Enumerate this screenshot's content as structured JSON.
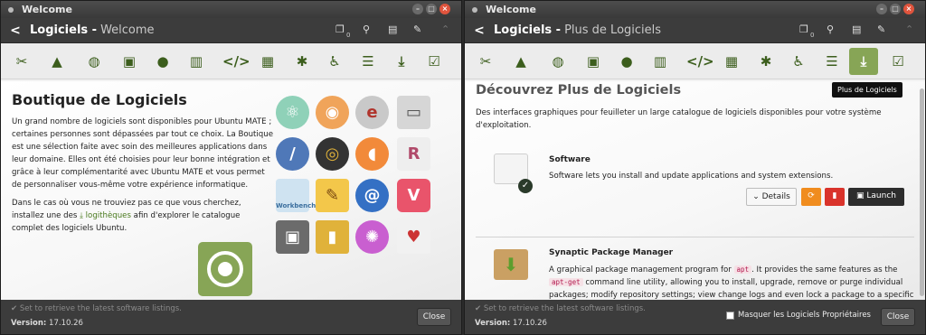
{
  "colors": {
    "accent": "#87a556",
    "icon": "#3c5e1d",
    "header_bg": "#3c3c3c",
    "title_bg": "#404040",
    "close_red": "#e0543d"
  },
  "window1": {
    "title": "Welcome",
    "header_title": "Logiciels -",
    "header_sub": "Welcome",
    "header_count": "0",
    "categories": [
      "scissors-icon",
      "graduation-cap-icon",
      "gamepad-icon",
      "image-icon",
      "globe-icon",
      "chart-bar-icon",
      "code-icon",
      "film-icon",
      "gear-icon",
      "accessibility-icon",
      "server-icon",
      "download-icon",
      "checkbox-icon"
    ],
    "heading": "Boutique de Logiciels",
    "para1": "Un grand nombre de logiciels sont disponibles pour Ubuntu MATE ; certaines personnes sont dépassées par tout ce choix. La Boutique est une sélection faite avec soin des meilleures applications dans leur domaine. Elles ont été choisies pour leur bonne intégration et grâce à leur complémentarité avec Ubuntu MATE et vous permet de personnaliser vous-même votre expérience informatique.",
    "para2_pre": "Dans le cas où vous ne trouviez pas ce que vous cherchez, installez une des",
    "para2_link": "logithèques",
    "para2_post": "afin d'explorer le catalogue complet des logiciels Ubuntu.",
    "app_icons": [
      "atom-icon",
      "blender-icon",
      "eclipse-icon",
      "server-workstation-icon",
      "kdenlive-icon",
      "disk-burner-icon",
      "mango-icon",
      "r-icon",
      "mysql-workbench-icon",
      "pencil-editor-icon",
      "chameleon-icon",
      "vivaldi-icon",
      "safe-icon",
      "sd-card-icon",
      "monster-icon",
      "cards-icon"
    ],
    "workbench_label": "Workbench",
    "footer_status": "Set to retrieve the latest software listings.",
    "version_label": "Version:",
    "version": "17.10.26",
    "close_label": "Close"
  },
  "window2": {
    "title": "Welcome",
    "header_title": "Logiciels -",
    "header_sub": "Plus de Logiciels",
    "header_count": "0",
    "categories": [
      "scissors-icon",
      "graduation-cap-icon",
      "gamepad-icon",
      "image-icon",
      "globe-icon",
      "chart-bar-icon",
      "code-icon",
      "film-icon",
      "gear-icon",
      "accessibility-icon",
      "server-icon",
      "download-icon",
      "checkbox-icon"
    ],
    "active_category": "download-icon",
    "tooltip": "Plus de Logiciels",
    "heading": "Découvrez Plus de Logiciels",
    "intro": "Des interfaces graphiques pour feuilleter un large catalogue de logiciels disponibles pour votre système d'exploitation.",
    "items": [
      {
        "name": "Software",
        "desc": "Software lets you install and update applications and system extensions.",
        "details_label": "Details",
        "launch_label": "Launch"
      },
      {
        "name": "Synaptic Package Manager",
        "desc_pre": "A graphical package management program for",
        "code1": "apt",
        "desc_mid": ". It provides the same features as the",
        "code2": "apt-get",
        "desc_post": "command line utility, allowing you to install, upgrade, remove or purge individual packages; modify repository settings; view change logs and even lock a package to a specific version."
      }
    ],
    "footer_status": "Set to retrieve the latest software listings.",
    "version_label": "Version:",
    "version": "17.10.26",
    "checkbox_label": "Masquer les Logiciels Propriétaires",
    "close_label": "Close"
  }
}
